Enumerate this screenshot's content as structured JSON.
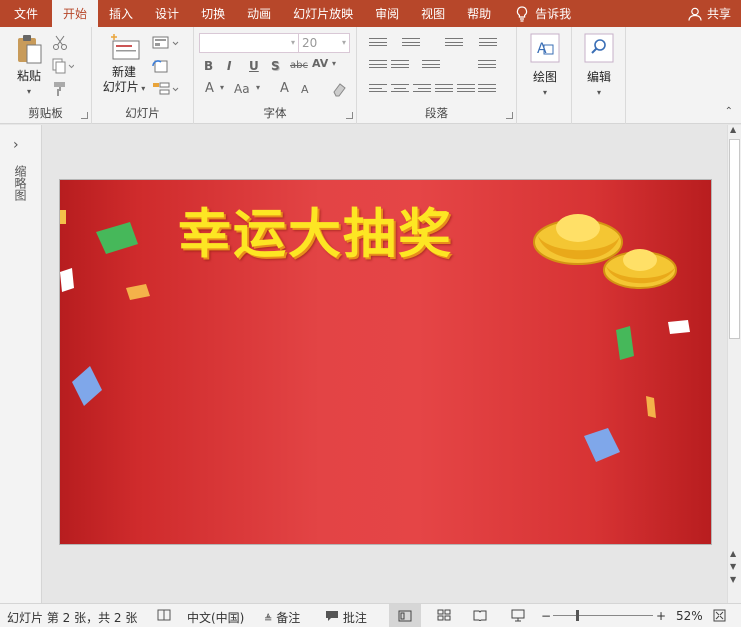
{
  "tabs": [
    {
      "label": "文件"
    },
    {
      "label": "开始",
      "active": true
    },
    {
      "label": "插入"
    },
    {
      "label": "设计"
    },
    {
      "label": "切换"
    },
    {
      "label": "动画"
    },
    {
      "label": "幻灯片放映"
    },
    {
      "label": "审阅"
    },
    {
      "label": "视图"
    },
    {
      "label": "帮助"
    }
  ],
  "tellme": "告诉我",
  "share": "共享",
  "ribbon": {
    "clipboard": {
      "paste": "粘贴",
      "label": "剪贴板"
    },
    "slides": {
      "new_line1": "新建",
      "new_line2": "幻灯片",
      "label": "幻灯片"
    },
    "font": {
      "font_size": "20",
      "bold": "B",
      "italic": "I",
      "underline": "U",
      "shadow": "S",
      "strike": "abc",
      "spacing": "AV",
      "font_color": "A",
      "case": "Aa",
      "grow": "A",
      "shrink": "A",
      "label": "字体"
    },
    "paragraph": {
      "label": "段落"
    },
    "drawing": {
      "label": "绘图"
    },
    "editing": {
      "label": "编辑"
    }
  },
  "leftpane": {
    "thumbnails_label": "缩略图"
  },
  "slide": {
    "title": "幸运大抽奖"
  },
  "statusbar": {
    "slide_info": "幻灯片 第 2 张，共 2 张",
    "language": "中文(中国)",
    "notes": "备注",
    "comments": "批注",
    "zoom": "52%"
  },
  "colors": {
    "accent": "#b7472a",
    "slide_red": "#e34445",
    "title_yellow": "#fde623"
  }
}
